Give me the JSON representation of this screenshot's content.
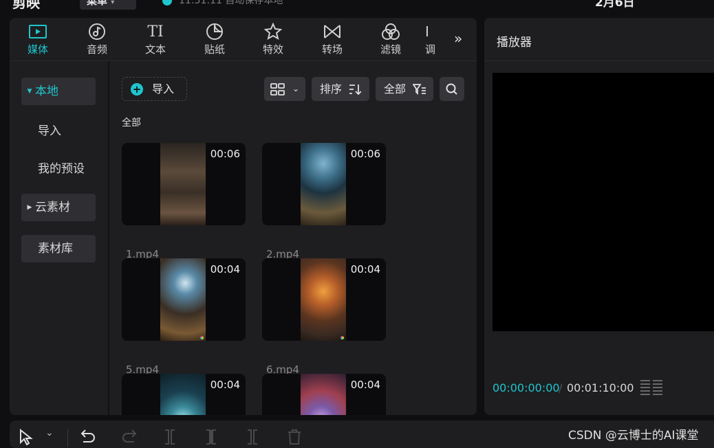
{
  "app": {
    "logo": "剪映",
    "menu_label": "菜单",
    "save_status": "11:31:11 自动保存本地",
    "project_title": "2月6日"
  },
  "tabs": [
    {
      "label": "媒体",
      "icon": "media-icon",
      "active": true
    },
    {
      "label": "音频",
      "icon": "audio-icon"
    },
    {
      "label": "文本",
      "icon": "text-icon"
    },
    {
      "label": "贴纸",
      "icon": "sticker-icon"
    },
    {
      "label": "特效",
      "icon": "effects-icon"
    },
    {
      "label": "转场",
      "icon": "transition-icon"
    },
    {
      "label": "滤镜",
      "icon": "filter-icon"
    },
    {
      "label": "调",
      "icon": "adjust-icon"
    }
  ],
  "sidebar": {
    "items": [
      {
        "label": "本地",
        "active": true,
        "expandable": true
      },
      {
        "label": "导入"
      },
      {
        "label": "我的预设"
      },
      {
        "label": "云素材",
        "expandable": true
      },
      {
        "label": "素材库"
      }
    ]
  },
  "toolbar": {
    "import_label": "导入",
    "sort_label": "排序",
    "filter_label": "全部"
  },
  "media": {
    "section_label": "全部",
    "items": [
      {
        "name": "1.mp4",
        "duration": "00:06"
      },
      {
        "name": "2.mp4",
        "duration": "00:06"
      },
      {
        "name": "5.mp4",
        "duration": "00:04"
      },
      {
        "name": "6.mp4",
        "duration": "00:04"
      },
      {
        "name": "",
        "duration": "00:04"
      },
      {
        "name": "",
        "duration": "00:04"
      }
    ]
  },
  "player": {
    "title": "播放器",
    "current_time": "00:00:00:00",
    "separator": "/",
    "total_time": "00:01:10:00"
  },
  "watermark": "CSDN @云博士的AI课堂",
  "colors": {
    "accent": "#1fc6cd",
    "panel": "#1e1e20",
    "background": "#0f0f11"
  }
}
